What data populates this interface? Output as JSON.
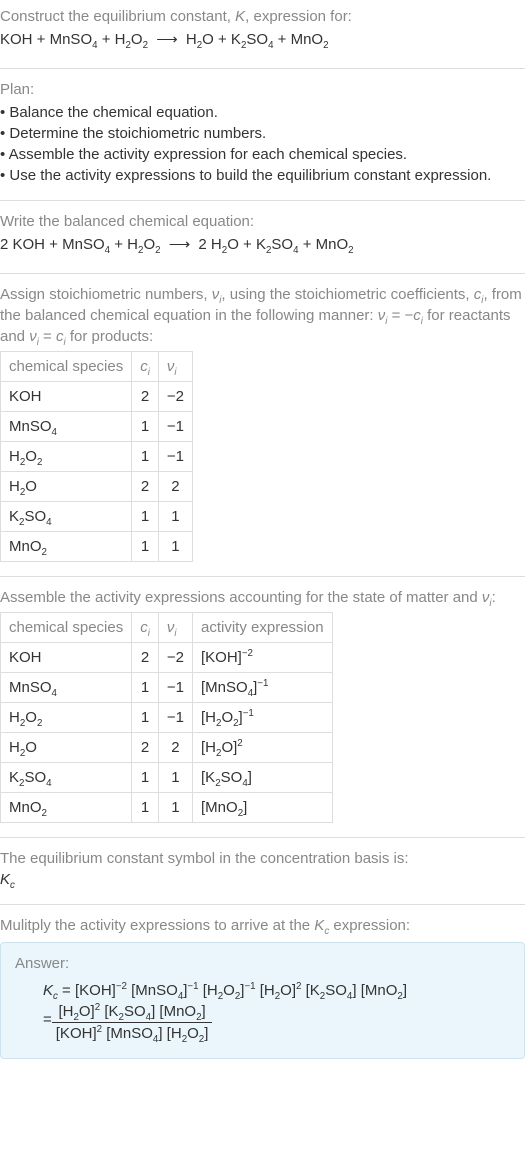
{
  "intro": {
    "prompt_line1": "Construct the equilibrium constant, ",
    "prompt_K": "K",
    "prompt_line1_tail": ", expression for:",
    "equation_html": "KOH + MnSO<sub>4</sub> + H<sub>2</sub>O<sub>2</sub> <span class='arrow'>⟶</span> H<sub>2</sub>O + K<sub>2</sub>SO<sub>4</sub> + MnO<sub>2</sub>"
  },
  "plan": {
    "label": "Plan:",
    "items": [
      "Balance the chemical equation.",
      "Determine the stoichiometric numbers.",
      "Assemble the activity expression for each chemical species.",
      "Use the activity expressions to build the equilibrium constant expression."
    ]
  },
  "balance": {
    "label": "Write the balanced chemical equation:",
    "equation_html": "2 KOH + MnSO<sub>4</sub> + H<sub>2</sub>O<sub>2</sub> <span class='arrow'>⟶</span> 2 H<sub>2</sub>O + K<sub>2</sub>SO<sub>4</sub> + MnO<sub>2</sub>"
  },
  "stoich_text": {
    "p1_html": "Assign stoichiometric numbers, <span class='ital'>ν<sub>i</sub></span>, using the stoichiometric coefficients, <span class='ital'>c<sub>i</sub></span>, from the balanced chemical equation in the following manner: <span class='ital'>ν<sub>i</sub></span> = −<span class='ital'>c<sub>i</sub></span> for reactants and <span class='ital'>ν<sub>i</sub></span> = <span class='ital'>c<sub>i</sub></span> for products:"
  },
  "table1": {
    "headers": {
      "c0": "chemical species",
      "c1_html": "<span class='ital'>c<sub>i</sub></span>",
      "c2_html": "<span class='ital'>ν<sub>i</sub></span>"
    },
    "rows": [
      {
        "sp_html": "KOH",
        "c": "2",
        "v": "−2"
      },
      {
        "sp_html": "MnSO<sub>4</sub>",
        "c": "1",
        "v": "−1"
      },
      {
        "sp_html": "H<sub>2</sub>O<sub>2</sub>",
        "c": "1",
        "v": "−1"
      },
      {
        "sp_html": "H<sub>2</sub>O",
        "c": "2",
        "v": "2"
      },
      {
        "sp_html": "K<sub>2</sub>SO<sub>4</sub>",
        "c": "1",
        "v": "1"
      },
      {
        "sp_html": "MnO<sub>2</sub>",
        "c": "1",
        "v": "1"
      }
    ]
  },
  "activity_text_html": "Assemble the activity expressions accounting for the state of matter and <span class='ital'>ν<sub>i</sub></span>:",
  "table2": {
    "headers": {
      "c0": "chemical species",
      "c1_html": "<span class='ital'>c<sub>i</sub></span>",
      "c2_html": "<span class='ital'>ν<sub>i</sub></span>",
      "c3": "activity expression"
    },
    "rows": [
      {
        "sp_html": "KOH",
        "c": "2",
        "v": "−2",
        "a_html": "[KOH]<sup>−2</sup>"
      },
      {
        "sp_html": "MnSO<sub>4</sub>",
        "c": "1",
        "v": "−1",
        "a_html": "[MnSO<sub>4</sub>]<sup>−1</sup>"
      },
      {
        "sp_html": "H<sub>2</sub>O<sub>2</sub>",
        "c": "1",
        "v": "−1",
        "a_html": "[H<sub>2</sub>O<sub>2</sub>]<sup>−1</sup>"
      },
      {
        "sp_html": "H<sub>2</sub>O",
        "c": "2",
        "v": "2",
        "a_html": "[H<sub>2</sub>O]<sup>2</sup>"
      },
      {
        "sp_html": "K<sub>2</sub>SO<sub>4</sub>",
        "c": "1",
        "v": "1",
        "a_html": "[K<sub>2</sub>SO<sub>4</sub>]"
      },
      {
        "sp_html": "MnO<sub>2</sub>",
        "c": "1",
        "v": "1",
        "a_html": "[MnO<sub>2</sub>]"
      }
    ]
  },
  "kc_basis": {
    "label": "The equilibrium constant symbol in the concentration basis is:",
    "sym_html": "<span class='ital'>K<sub>c</sub></span>"
  },
  "multiply_html": "Mulitply the activity expressions to arrive at the <span class='ital'>K<sub>c</sub></span> expression:",
  "answer": {
    "label": "Answer:",
    "line1_html": "<span class='ital'>K<sub>c</sub></span> = [KOH]<sup>−2</sup> [MnSO<sub>4</sub>]<sup>−1</sup> [H<sub>2</sub>O<sub>2</sub>]<sup>−1</sup> [H<sub>2</sub>O]<sup>2</sup> [K<sub>2</sub>SO<sub>4</sub>] [MnO<sub>2</sub>]",
    "frac_num_html": "[H<sub>2</sub>O]<sup>2</sup> [K<sub>2</sub>SO<sub>4</sub>] [MnO<sub>2</sub>]",
    "frac_den_html": "[KOH]<sup>2</sup> [MnSO<sub>4</sub>] [H<sub>2</sub>O<sub>2</sub>]",
    "eq": "= "
  }
}
